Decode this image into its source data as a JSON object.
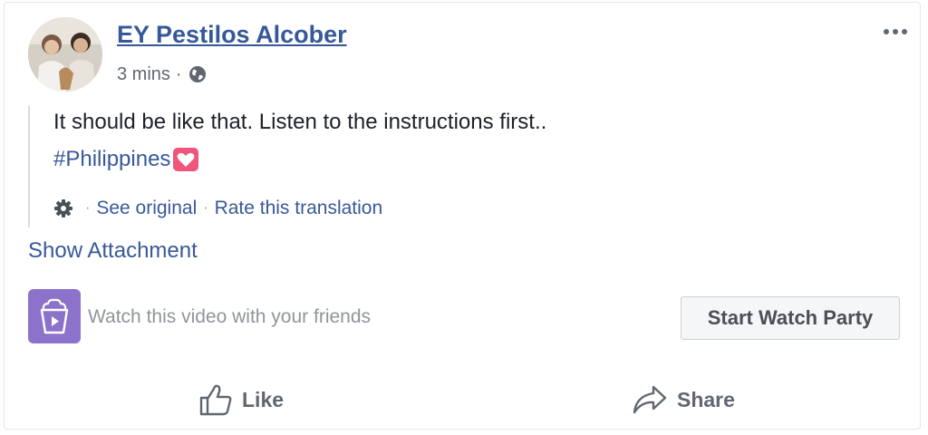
{
  "post": {
    "author": "EY Pestilos Alcober",
    "timestamp": "3 mins",
    "separator_dot": "·",
    "privacy_icon": "globe-icon",
    "menu_icon": "more-options-icon"
  },
  "content": {
    "text": "It should be like that. Listen to the instructions first..",
    "hashtag": "#Philippines",
    "emoji": "heart-emoji"
  },
  "translation": {
    "settings_icon": "gear-icon",
    "separator": "·",
    "see_original": "See original",
    "rate_translation": "Rate this translation"
  },
  "attachment": {
    "show_label": "Show Attachment"
  },
  "watch_party": {
    "icon": "watch-party-icon",
    "prompt": "Watch this video with your friends",
    "button_label": "Start Watch Party",
    "icon_color": "#8c72cb"
  },
  "actions": {
    "like_label": "Like",
    "share_label": "Share"
  },
  "colors": {
    "link": "#385898",
    "text": "#1d2129",
    "muted": "#90949c",
    "accent_heart": "#f0557c"
  }
}
